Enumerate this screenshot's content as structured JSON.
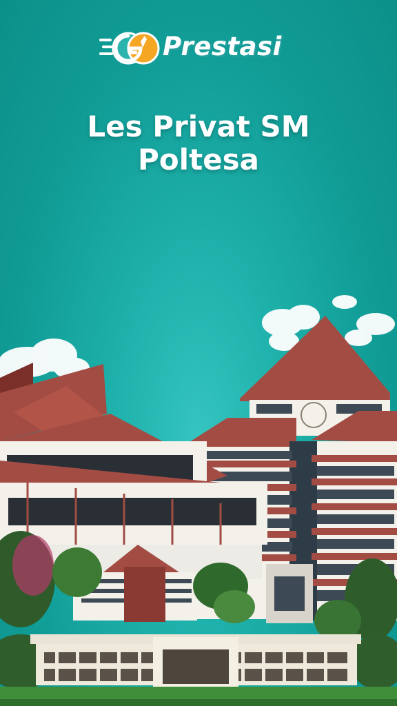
{
  "brand": {
    "name": "Prestasi",
    "colors": {
      "teal": "#2bb3ad",
      "orange": "#f5a623",
      "white": "#ffffff"
    }
  },
  "headline": {
    "line1": "Les Privat SM",
    "line2": "Poltesa"
  },
  "scene": {
    "description_icons": [
      "cloud-icon",
      "campus-building-icon"
    ],
    "colors": {
      "roof": "#a24c44",
      "wall": "#f3f1ea",
      "grass": "#3f8f3a",
      "sky": "#1fb1ab"
    }
  }
}
